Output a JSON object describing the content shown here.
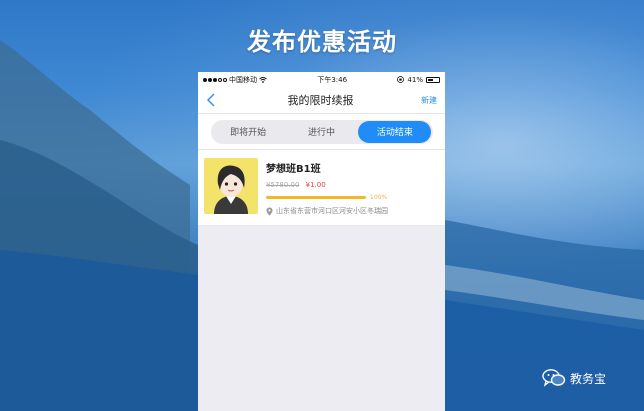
{
  "headline": "发布优惠活动",
  "status_bar": {
    "carrier": "中国移动",
    "time": "下午3:46",
    "battery": "41%"
  },
  "nav": {
    "title": "我的限时续报",
    "new_label": "新建",
    "back_icon": "chevron-left-icon"
  },
  "tabs": [
    {
      "label": "即将开始",
      "active": false
    },
    {
      "label": "进行中",
      "active": false
    },
    {
      "label": "活动结束",
      "active": true
    }
  ],
  "course": {
    "title": "梦想班B1班",
    "price_original": "¥5780.00",
    "price_current": "¥1.00",
    "progress": 1.0,
    "progress_label": "100%",
    "address": "山东省东营市河口区河安小区冬瑞园"
  },
  "watermark": {
    "label": "教务宝",
    "icon": "wechat-icon"
  },
  "colors": {
    "accent": "#1f8cf7",
    "price_red": "#e8413b",
    "progress": "#f5b72a"
  }
}
